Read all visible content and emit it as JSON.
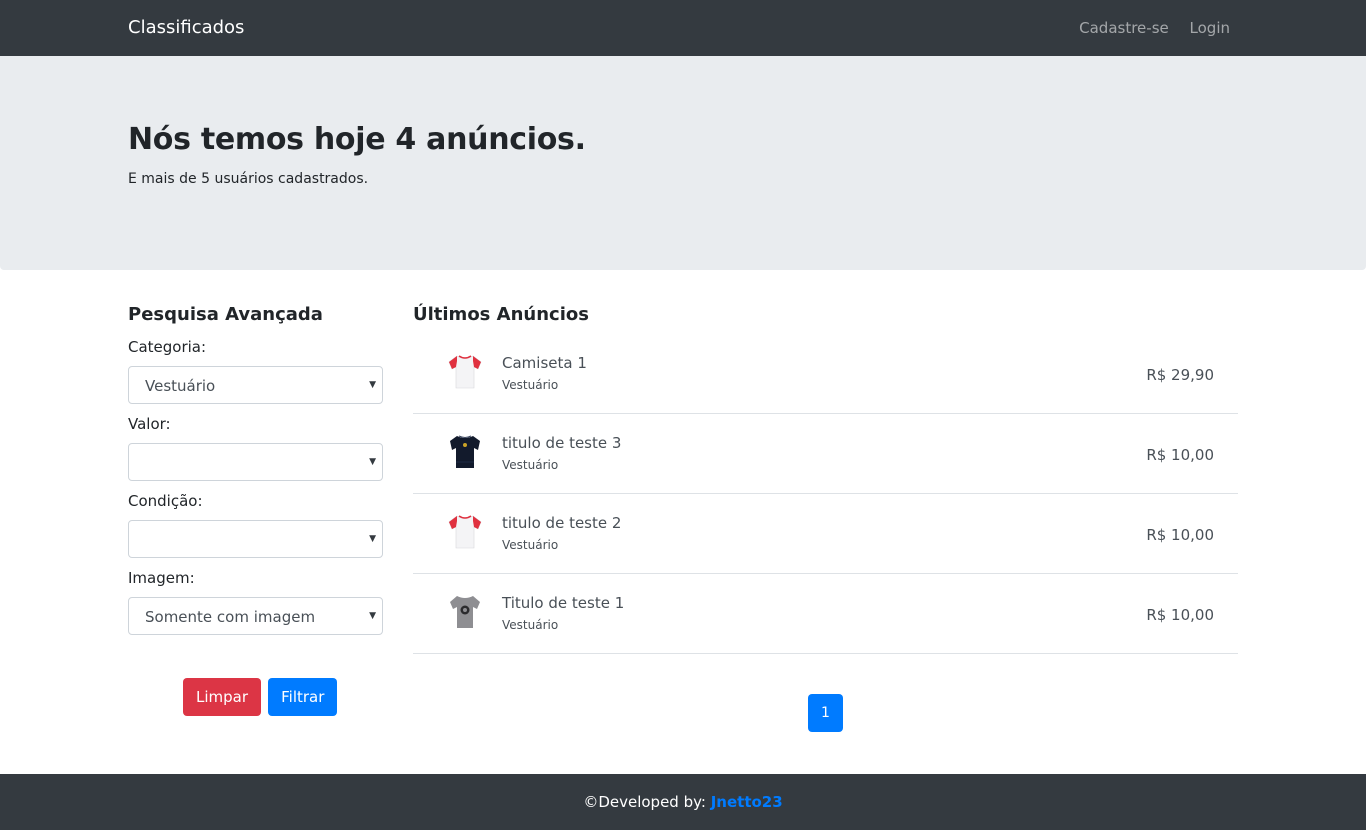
{
  "nav": {
    "brand": "Classificados",
    "links": [
      "Cadastre-se",
      "Login"
    ]
  },
  "hero": {
    "title": "Nós temos hoje 4 anúncios.",
    "subtitle": "E mais de 5 usuários cadastrados."
  },
  "search": {
    "title": "Pesquisa Avançada",
    "fields": [
      {
        "label": "Categoria:",
        "value": "Vestuário"
      },
      {
        "label": "Valor:",
        "value": ""
      },
      {
        "label": "Condição:",
        "value": ""
      },
      {
        "label": "Imagem:",
        "value": "Somente com imagem"
      }
    ],
    "clear_label": "Limpar",
    "filter_label": "Filtrar"
  },
  "listings": {
    "title": "Últimos Anúncios",
    "items": [
      {
        "title": "Camiseta 1",
        "category": "Vestuário",
        "price": "R$ 29,90",
        "thumb": "raglan-red-white-shirt"
      },
      {
        "title": "titulo de teste 3",
        "category": "Vestuário",
        "price": "R$ 10,00",
        "thumb": "dark-navy-shirt"
      },
      {
        "title": "titulo de teste 2",
        "category": "Vestuário",
        "price": "R$ 10,00",
        "thumb": "raglan-red-white-shirt"
      },
      {
        "title": "Titulo de teste 1",
        "category": "Vestuário",
        "price": "R$ 10,00",
        "thumb": "gray-print-shirt"
      }
    ],
    "page": "1"
  },
  "footer": {
    "prefix": "©Developed by: ",
    "author": "Jnetto23"
  },
  "colors": {
    "navbar": "#343a40",
    "jumbotron": "#e9ecef",
    "primary": "#007bff",
    "danger": "#dc3545"
  }
}
